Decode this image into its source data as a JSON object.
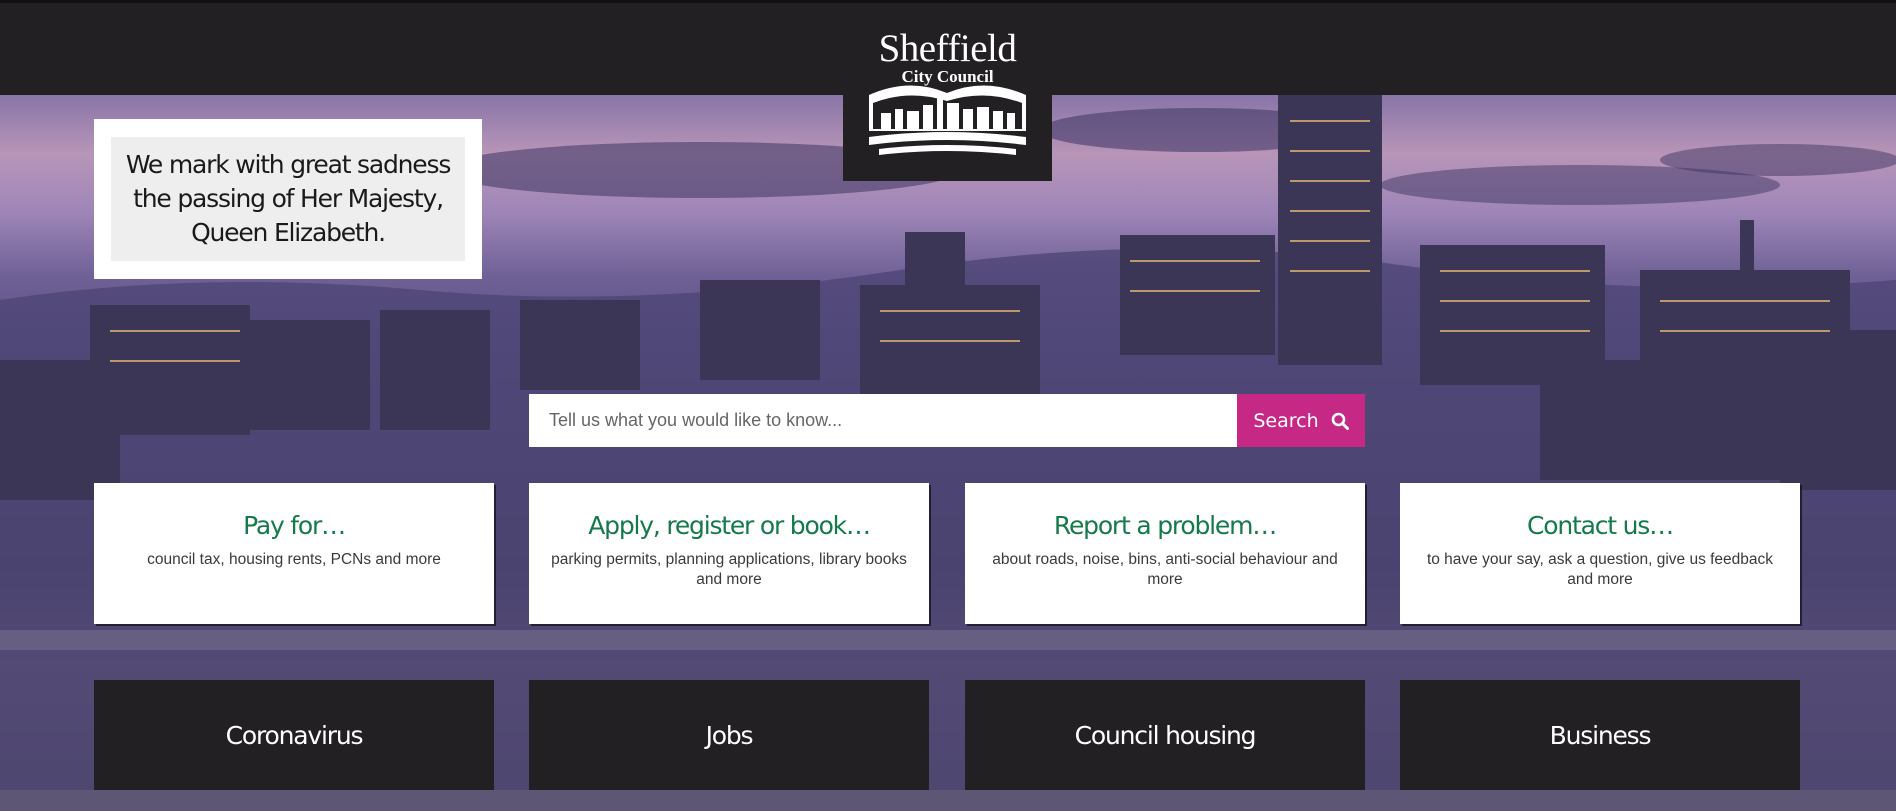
{
  "brand": {
    "name_line1": "Sheffield",
    "name_line2": "City Council"
  },
  "notice": {
    "text": "We mark with great sadness the passing of Her Majesty, Queen Elizabeth."
  },
  "search": {
    "placeholder": "Tell us what you would like to know...",
    "button_label": "Search",
    "button_icon": "search-icon",
    "button_color": "#c62886"
  },
  "cards": [
    {
      "title": "Pay for…",
      "description": "council tax, housing rents, PCNs and more"
    },
    {
      "title": "Apply, register or book…",
      "description": "parking permits, planning applications, library books and more"
    },
    {
      "title": "Report a problem…",
      "description": "about roads, noise, bins, anti-social behaviour and more"
    },
    {
      "title": "Contact us…",
      "description": "to have your say, ask a question, give us feedback and more"
    }
  ],
  "tiles": [
    {
      "label": "Coronavirus"
    },
    {
      "label": "Jobs"
    },
    {
      "label": "Council housing"
    },
    {
      "label": "Business"
    }
  ],
  "colors": {
    "header_bg": "#222022",
    "card_title": "#157a4b",
    "tile_bg": "#222022"
  }
}
